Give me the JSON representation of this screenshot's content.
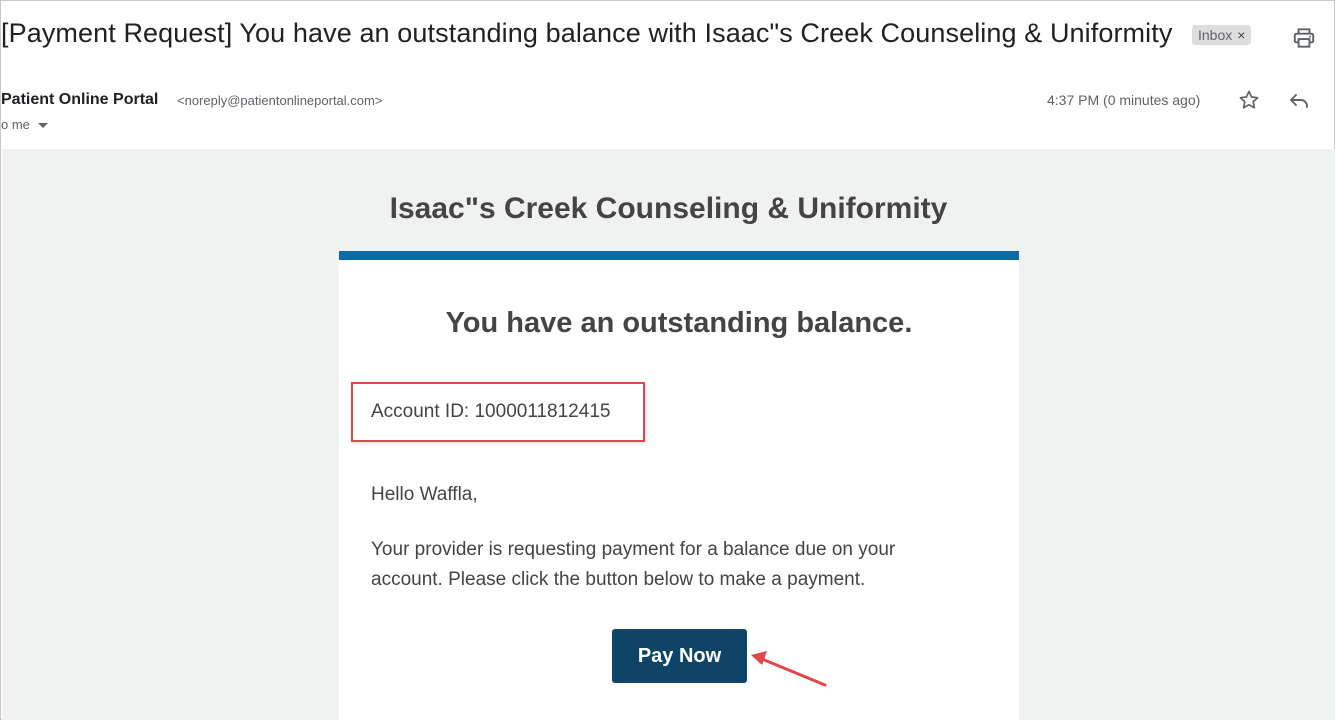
{
  "header": {
    "subject": "[Payment Request] You have an outstanding balance with Isaac\"s Creek Counseling & Uniformity",
    "label_chip": {
      "text": "Inbox",
      "remove_glyph": "×"
    },
    "print_icon": "print-icon"
  },
  "sender": {
    "name": "Patient Online Portal",
    "email": "<noreply@patientonlineportal.com>",
    "recipient": "o me",
    "timestamp": "4:37 PM (0 minutes ago)",
    "star_icon": "star-icon",
    "reply_icon": "reply-icon"
  },
  "email": {
    "practice_name": "Isaac\"s Creek Counseling & Uniformity",
    "headline": "You have an outstanding balance.",
    "account_id_line": "Account ID: 1000011812415",
    "greeting": "Hello Waffla,",
    "message": "Your provider is requesting payment for a balance due on your account. Please click the button below to make a payment.",
    "pay_button_label": "Pay Now"
  },
  "colors": {
    "accent_bar": "#0b6aa6",
    "pay_button": "#0f4466",
    "annotation_red": "#e0474c",
    "body_background": "#f0f2f2"
  }
}
